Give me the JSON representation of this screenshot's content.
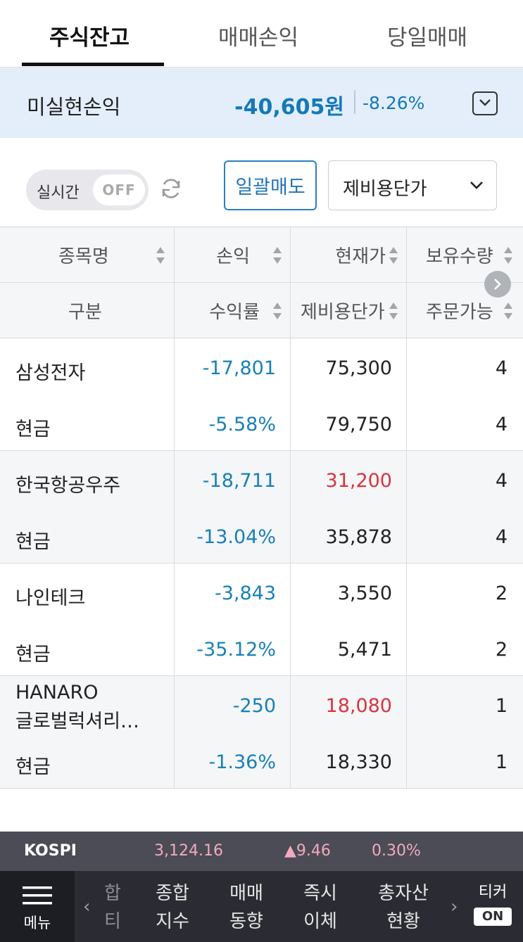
{
  "tabs": [
    {
      "label": "주식잔고",
      "active": true
    },
    {
      "label": "매매손익",
      "active": false
    },
    {
      "label": "당일매매",
      "active": false
    }
  ],
  "summary": {
    "label": "미실현손익",
    "amount": "-40,605원",
    "rate": "-8.26%",
    "toggle_icon": "chevron-down-icon"
  },
  "controls": {
    "realtime_label": "실시간",
    "realtime_state": "OFF",
    "refresh_icon": "refresh-icon",
    "bulk_sell_label": "일괄매도",
    "sort_selected": "제비용단가"
  },
  "table": {
    "headers_row1": [
      "종목명",
      "손익",
      "현재가",
      "보유수량"
    ],
    "headers_row2": [
      "구분",
      "수익률",
      "제비용단가",
      "주문가능"
    ],
    "rows": [
      {
        "name": "삼성전자",
        "type": "현금",
        "pl": "-17,801",
        "rate": "-5.58%",
        "price": "75,300",
        "price_color": "dark",
        "cost": "79,750",
        "qty": "4",
        "avail": "4"
      },
      {
        "name": "한국항공우주",
        "type": "현금",
        "pl": "-18,711",
        "rate": "-13.04%",
        "price": "31,200",
        "price_color": "red",
        "cost": "35,878",
        "qty": "4",
        "avail": "4"
      },
      {
        "name": "나인테크",
        "type": "현금",
        "pl": "-3,843",
        "rate": "-35.12%",
        "price": "3,550",
        "price_color": "dark",
        "cost": "5,471",
        "qty": "2",
        "avail": "2"
      },
      {
        "name_line1": "HANARO",
        "name_line2": "글로벌럭셔리…",
        "type": "현금",
        "pl": "-250",
        "rate": "-1.36%",
        "price": "18,080",
        "price_color": "red",
        "cost": "18,330",
        "qty": "1",
        "avail": "1"
      }
    ]
  },
  "index": {
    "name": "KOSPI",
    "value": "3,124.16",
    "change": "▲9.46",
    "rate": "0.30%"
  },
  "bottom_nav": {
    "menu_label": "메뉴",
    "cut_item": "합\n티",
    "items": [
      "종합\n지수",
      "매매\n동향",
      "즉시\n이체",
      "총자산\n현황"
    ],
    "ticker_label": "티커",
    "ticker_state": "ON"
  },
  "colors": {
    "accent_blue": "#1f73b7",
    "loss_blue": "#1880b8",
    "up_red": "#d8343d",
    "summary_bg": "#e3eefa"
  }
}
